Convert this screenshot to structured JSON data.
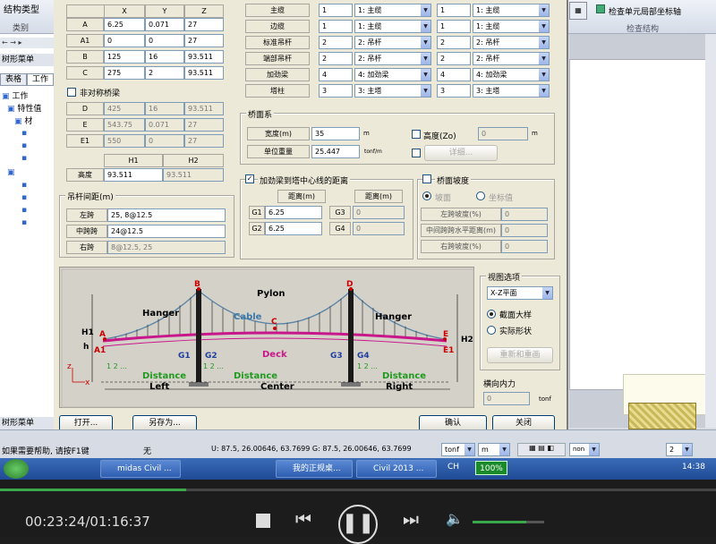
{
  "ribbon": {
    "group_type_label": "结构类型",
    "tab_label_1": "类别",
    "check_label": "检查单元局部坐标轴",
    "check_group_label": "检查结构"
  },
  "left_panel": {
    "tab_1": "表格",
    "tab_2": "工作",
    "menu_label": "树形菜单",
    "tree_1": "工作",
    "tree_2": "特性值",
    "tree_3": "材",
    "bottom_tab": "树形菜单"
  },
  "cable_table": {
    "headers": [
      "X",
      "Y",
      "Z"
    ],
    "rows": [
      {
        "label": "A",
        "x": "6.25",
        "y": "0.071",
        "z": "27"
      },
      {
        "label": "A1",
        "x": "0",
        "y": "0",
        "z": "27"
      },
      {
        "label": "B",
        "x": "125",
        "y": "16",
        "z": "93.511"
      },
      {
        "label": "C",
        "x": "275",
        "y": "2",
        "z": "93.511"
      }
    ],
    "asym_label": "非对称桥梁",
    "asym_rows": [
      {
        "label": "D",
        "x": "425",
        "y": "16",
        "z": "93.511"
      },
      {
        "label": "E",
        "x": "543.75",
        "y": "0.071",
        "z": "27"
      },
      {
        "label": "E1",
        "x": "550",
        "y": "0",
        "z": "27"
      }
    ],
    "h_headers": [
      "H1",
      "H2"
    ],
    "height_label": "高度",
    "h1": "93.511",
    "h2": "93.511"
  },
  "hanger": {
    "title": "吊杆间距(m)",
    "rows": [
      {
        "label": "左跨",
        "value": "25, 8@12.5"
      },
      {
        "label": "中跨跨",
        "value": "24@12.5"
      },
      {
        "label": "右跨",
        "value": "8@12.5, 25"
      }
    ]
  },
  "members": {
    "rows": [
      {
        "label": "主缆",
        "n1": "1",
        "t1": "1: 主缆",
        "n2": "1",
        "t2": "1: 主缆"
      },
      {
        "label": "边缆",
        "n1": "1",
        "t1": "1: 主缆",
        "n2": "1",
        "t2": "1: 主缆"
      },
      {
        "label": "标准吊杆",
        "n1": "2",
        "t1": "2: 吊杆",
        "n2": "2",
        "t2": "2: 吊杆"
      },
      {
        "label": "端部吊杆",
        "n1": "2",
        "t1": "2: 吊杆",
        "n2": "2",
        "t2": "2: 吊杆"
      },
      {
        "label": "加劲梁",
        "n1": "4",
        "t1": "4: 加劲梁",
        "n2": "4",
        "t2": "4: 加劲梁"
      },
      {
        "label": "塔柱",
        "n1": "3",
        "t1": "3: 主塔",
        "n2": "3",
        "t2": "3: 主塔"
      }
    ]
  },
  "deck_system": {
    "title": "桥面系",
    "width_label": "宽度(m)",
    "width_value": "35",
    "width_unit": "m",
    "weight_label": "单位重量",
    "weight_value": "25.447",
    "weight_unit": "tonf/m",
    "elev_label": "高度(Zo)",
    "elev_value": "0",
    "elev_unit": "m",
    "detail_button": "详细..."
  },
  "dist": {
    "title": "加劲梁到塔中心线的距离",
    "col1": "距离(m)",
    "col2": "距离(m)",
    "rows": [
      {
        "l1": "G1",
        "v1": "6.25",
        "l2": "G3",
        "v2": "0"
      },
      {
        "l1": "G2",
        "v1": "6.25",
        "l2": "G4",
        "v2": "0"
      }
    ]
  },
  "slope": {
    "title": "桥面坡度",
    "opt1": "坡面",
    "opt2": "坐标值",
    "rows": [
      {
        "label": "左跨坡度(%)",
        "value": "0"
      },
      {
        "label": "中间跨跨水平距离(m)",
        "value": "0"
      },
      {
        "label": "右跨坡度(%)",
        "value": "0"
      }
    ]
  },
  "diagram": {
    "pylon": "Pylon",
    "cable": "Cable",
    "hanger_left": "Hanger",
    "hanger_right": "Hanger",
    "deck": "Deck",
    "pts": {
      "A": "A",
      "A1": "A1",
      "B": "B",
      "C": "C",
      "D": "D",
      "E": "E",
      "E1": "E1",
      "G1": "G1",
      "G2": "G2",
      "G3": "G3",
      "G4": "G4"
    },
    "h1": "H1",
    "h2": "H2",
    "h": "h",
    "z": "z",
    "x": "x",
    "dist": "Distance",
    "left": "Left",
    "center": "Center",
    "right": "Right",
    "ticks": "1 2 ..."
  },
  "view_opts": {
    "title": "视图选项",
    "plane": "X-Z平面",
    "r1": "截面大样",
    "r2": "实际形状",
    "btn": "重新和重画",
    "axial_label": "横向内力",
    "axial_value": "0",
    "axial_unit": "tonf"
  },
  "footer": {
    "open": "打开...",
    "saveas": "另存为...",
    "ok": "确认",
    "close": "关闭"
  },
  "statusbar": {
    "help": "如果需要帮助, 请按F1键",
    "none": "无",
    "coords": "U: 87.5, 26.00646, 63.7699  G: 87.5, 26.00646, 63.7699",
    "unit_force": "tonf",
    "unit_len": "m",
    "none2": "non",
    "page": "2"
  },
  "taskbar": {
    "items": [
      "midas Civil ...",
      "我的正规桌...",
      "Civil 2013 ..."
    ],
    "pct": "100%",
    "ch": "CH",
    "time": "14:38"
  },
  "player": {
    "time": "00:23:24/01:16:37",
    "progress": 0.26
  },
  "colors": {
    "dlg": "#ece9d8",
    "deck": "#c8178a",
    "pylon": "#1a1a1a",
    "distance": "#1f9a1f",
    "label_blue": "#1f3f9f"
  }
}
